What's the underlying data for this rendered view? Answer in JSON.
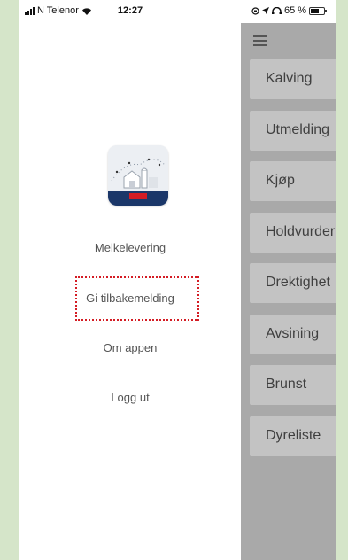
{
  "status_bar": {
    "carrier": "N Telenor",
    "time": "12:27",
    "battery": "65 %"
  },
  "drawer": {
    "menu_items": [
      {
        "label": "Melkelevering"
      },
      {
        "label": "Gi tilbakemelding"
      },
      {
        "label": "Om appen"
      },
      {
        "label": "Logg ut"
      }
    ]
  },
  "main": {
    "cards": [
      {
        "label": "Kalving"
      },
      {
        "label": "Utmelding"
      },
      {
        "label": "Kjøp"
      },
      {
        "label": "Holdvurdering"
      },
      {
        "label": "Drektighet"
      },
      {
        "label": "Avsining"
      },
      {
        "label": "Brunst"
      },
      {
        "label": "Dyreliste"
      }
    ]
  },
  "colors": {
    "page_background": "#d5e5c9",
    "overlay": "#a9a9a9",
    "card": "#c3c3c3",
    "highlight": "#d41c24",
    "logo_banner": "#1b3769"
  }
}
